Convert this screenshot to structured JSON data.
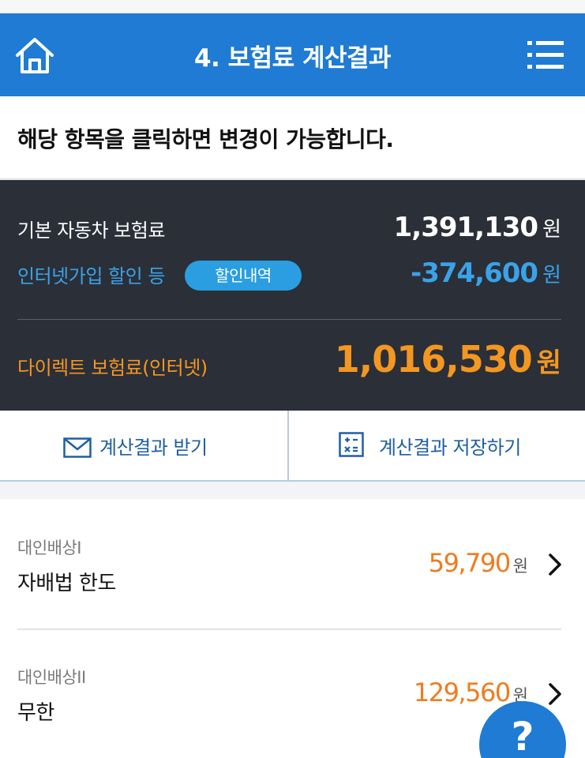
{
  "header": {
    "title": "4. 보험료 계산결과",
    "home_icon": "home-icon",
    "menu_icon": "list-menu-icon"
  },
  "notice": {
    "text": "해당 항목을 클릭하면 변경이 가능합니다."
  },
  "summary": {
    "base": {
      "label": "기본 자동차 보험료",
      "amount": "1,391,130",
      "unit": "원"
    },
    "discount": {
      "label": "인터넷가입 할인 등",
      "badge": "할인내역",
      "amount": "-374,600",
      "unit": "원"
    },
    "total": {
      "label": "다이렉트 보험료(인터넷)",
      "amount": "1,016,530",
      "unit": "원"
    }
  },
  "actions": {
    "receive": {
      "label": "계산결과 받기",
      "icon": "envelope-icon"
    },
    "save": {
      "label": "계산결과 저장하기",
      "icon": "calculator-icon"
    }
  },
  "coverages": [
    {
      "category": "대인배상I",
      "name": "자배법 한도",
      "amount": "59,790",
      "unit": "원"
    },
    {
      "category": "대인배상II",
      "name": "무한",
      "amount": "129,560",
      "unit": "원"
    }
  ],
  "help": {
    "label": "?"
  },
  "colors": {
    "header_bg": "#1f7bd3",
    "summary_bg": "#2b2f38",
    "discount_blue": "#3aa2e8",
    "total_orange": "#f39722",
    "price_orange": "#f07b1e"
  }
}
